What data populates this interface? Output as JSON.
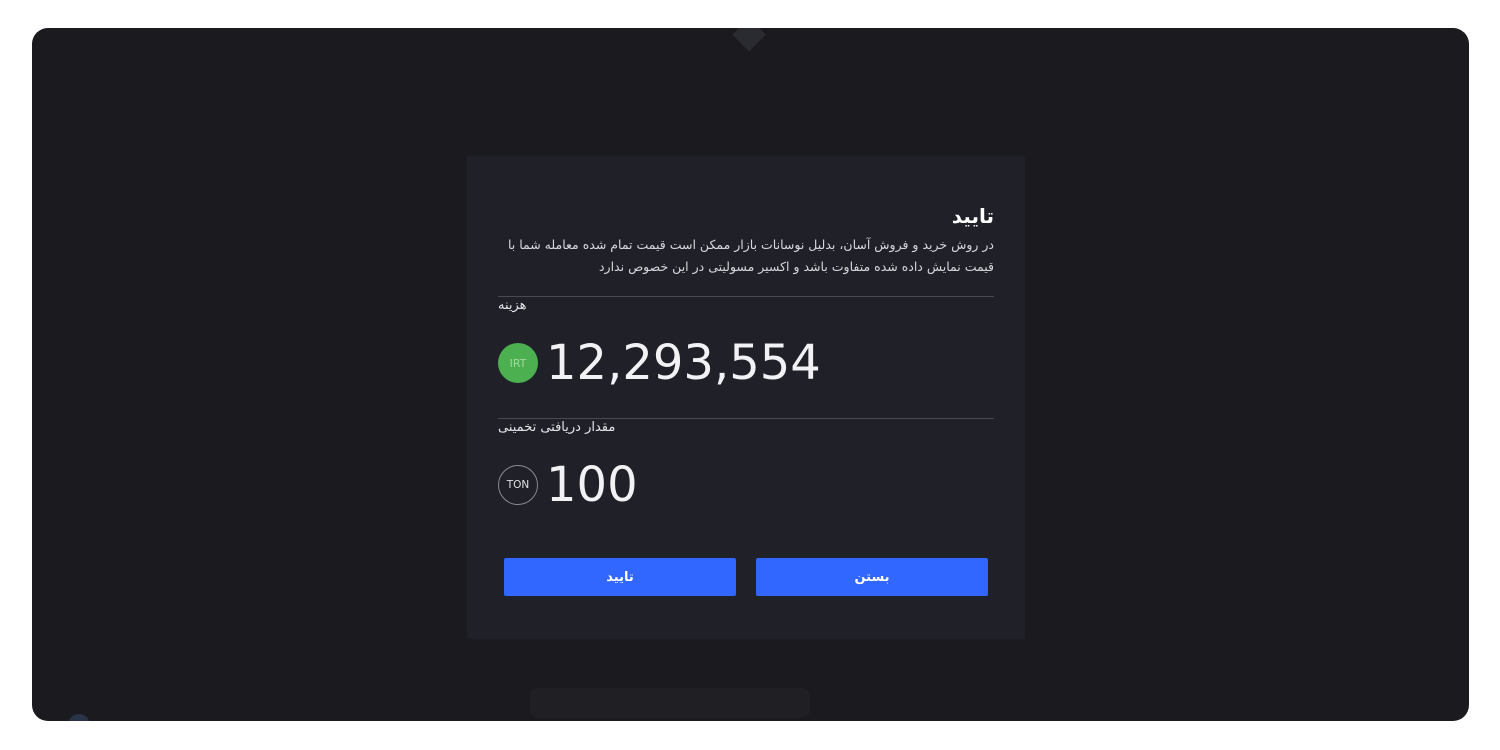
{
  "dialog": {
    "title": "تایید",
    "message": "در روش خرید و فروش آسان، بدلیل نوسانات بازار ممکن است قیمت تمام شده معامله شما با قیمت نمایش داده شده متفاوت باشد و اکسیر مسولیتی در این خصوص ندارد",
    "cost": {
      "label": "هزینه",
      "currency": "IRT",
      "amount": "12,293,554",
      "currency_color": "#4caf50"
    },
    "received": {
      "label": "مقدار دریافتی تخمینی",
      "currency": "TON",
      "amount": "100"
    },
    "buttons": {
      "close_label": "بستن",
      "confirm_label": "تایید",
      "color": "#3166ff"
    }
  }
}
